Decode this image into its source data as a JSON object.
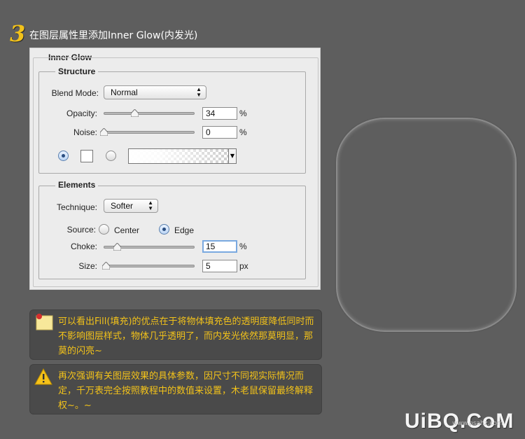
{
  "step": {
    "number": "3",
    "title": "在图层属性里添加Inner Glow(内发光)"
  },
  "dialog": {
    "section_title": "Inner Glow",
    "structure": {
      "title": "Structure",
      "blend_mode_label": "Blend Mode:",
      "blend_mode_value": "Normal",
      "opacity_label": "Opacity:",
      "opacity_value": "34",
      "opacity_unit": "%",
      "opacity_fraction": 0.34,
      "noise_label": "Noise:",
      "noise_value": "0",
      "noise_unit": "%",
      "noise_fraction": 0.0,
      "fill_mode": "solid-color",
      "solid_color": "#ffffff"
    },
    "elements": {
      "title": "Elements",
      "technique_label": "Technique:",
      "technique_value": "Softer",
      "source_label": "Source:",
      "source_options": [
        "Center",
        "Edge"
      ],
      "source_selected": "Edge",
      "choke_label": "Choke:",
      "choke_value": "15",
      "choke_unit": "%",
      "choke_fraction": 0.15,
      "size_label": "Size:",
      "size_value": "5",
      "size_unit": "px",
      "size_fraction": 0.02
    }
  },
  "notes": [
    {
      "icon": "sticky-note-icon",
      "text": "可以看出Fill(填充)的优点在于将物体填充色的透明度降低同时而不影响图层样式，物体几乎透明了，而内发光依然那莫明显，那莫的闪亮~"
    },
    {
      "icon": "warning-icon",
      "text": "再次强调有关图层效果的具体参数，因尺寸不同视实际情况而定，千万表完全按照教程中的数值来设置，木老鼠保留最终解释权~。~"
    }
  ],
  "watermark": {
    "text": "UiBQ.CoM",
    "sub": "www.psahz.com"
  },
  "colors": {
    "accent": "#f2c21a",
    "background": "#5e5e5e",
    "panel": "#ececec",
    "note_bg": "#4a4a4a"
  }
}
